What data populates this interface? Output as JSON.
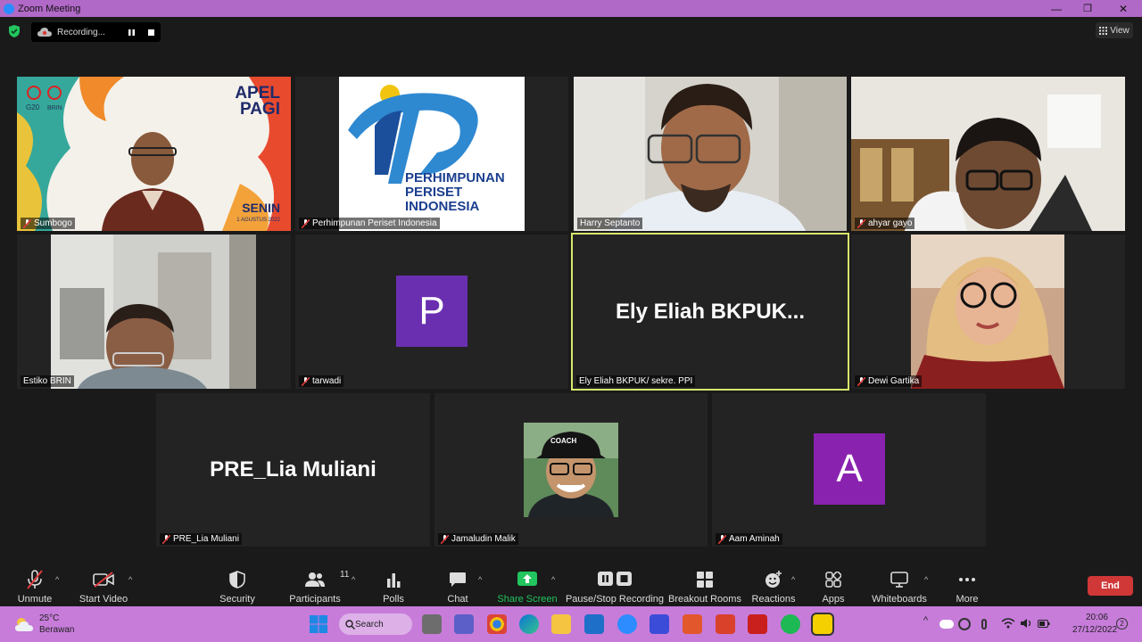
{
  "window": {
    "title": "Zoom Meeting",
    "minimize": "—",
    "maximize": "❐",
    "close": "✕"
  },
  "topbar": {
    "recording_label": "Recording...",
    "view_label": "View"
  },
  "participants": [
    {
      "name": "Sumbogo",
      "muted": true,
      "slide_title": "APEL\nPAGI",
      "slide_day": "SENIN",
      "slide_date": "1 AGUSTUS 2022"
    },
    {
      "name": "Perhimpunan Periset Indonesia",
      "muted": true,
      "logo_text_1": "PERHIMPUNAN",
      "logo_text_2": "PERISET",
      "logo_text_3": "INDONESIA"
    },
    {
      "name": "Harry Septanto",
      "muted": false
    },
    {
      "name": "ahyar gayo",
      "muted": true
    },
    {
      "name": "Estiko BRIN",
      "muted": false
    },
    {
      "name": "tarwadi",
      "muted": true,
      "avatar_letter": "P"
    },
    {
      "name": "Ely Eliah BKPUK/ sekre.  PPI",
      "muted": false,
      "display_name": "Ely  Eliah  BKPUK..."
    },
    {
      "name": "Dewi Gartika",
      "muted": true
    },
    {
      "name": "PRE_Lia Muliani",
      "muted": true,
      "display_name": "PRE_Lia Muliani"
    },
    {
      "name": "Jamaludin Malik",
      "muted": true,
      "cap_text": "COACH"
    },
    {
      "name": "Aam Aminah",
      "muted": true,
      "avatar_letter": "A"
    }
  ],
  "toolbar": {
    "unmute": "Unmute",
    "start_video": "Start Video",
    "security": "Security",
    "participants": "Participants",
    "participants_count": "11",
    "polls": "Polls",
    "chat": "Chat",
    "share_screen": "Share Screen",
    "pause_stop_recording": "Pause/Stop Recording",
    "breakout_rooms": "Breakout Rooms",
    "reactions": "Reactions",
    "apps": "Apps",
    "whiteboards": "Whiteboards",
    "more": "More",
    "end": "End"
  },
  "taskbar": {
    "weather_temp": "25°C",
    "weather_desc": "Berawan",
    "search_label": "Search",
    "time": "20:06",
    "date": "27/12/2022",
    "notification_count": "2"
  },
  "colors": {
    "title_bar": "#b169c7",
    "taskbar": "#c77cda",
    "share_green": "#22c55e",
    "end_red": "#d03737",
    "active_border": "#d8e86b",
    "avatar_purple": "#6a2fb0"
  }
}
